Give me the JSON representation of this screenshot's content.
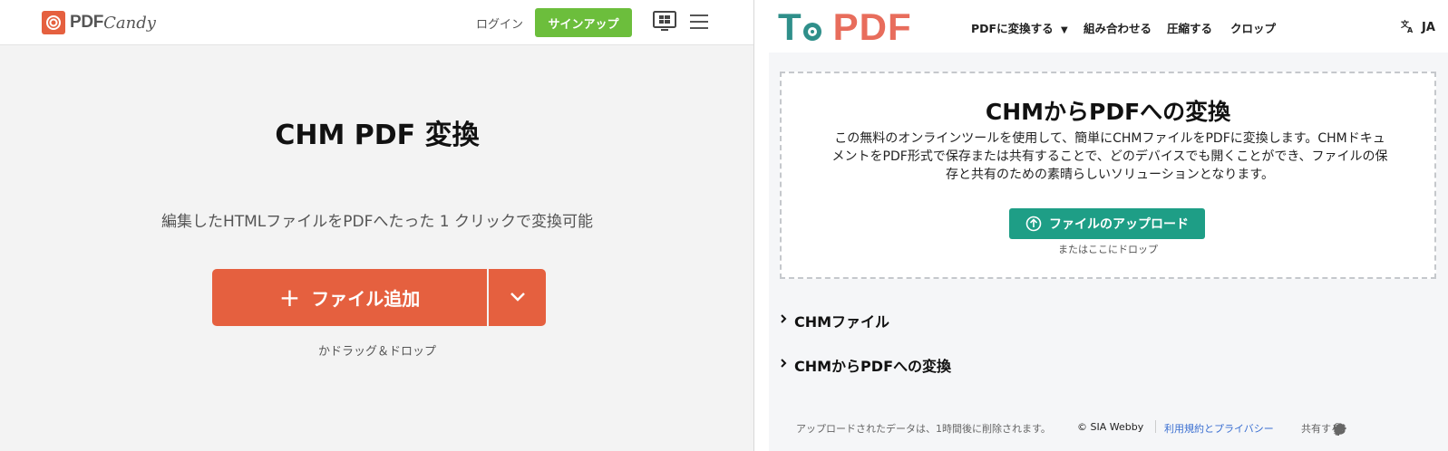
{
  "left": {
    "logo": {
      "pdf": "PDF",
      "candy": "Candy"
    },
    "header": {
      "login": "ログイン",
      "signup": "サインアップ"
    },
    "title": "CHM PDF 変換",
    "subtitle": "編集したHTMLファイルをPDFへたった 1 クリックで変換可能",
    "add_button": {
      "plus": "+",
      "label": "ファイル追加"
    },
    "drop_hint": "かドラッグ＆ドロップ",
    "colors": {
      "accent": "#e5603f",
      "signup": "#6cbe3c"
    }
  },
  "right": {
    "logo": {
      "t": "T",
      "pdf": "PDF"
    },
    "nav": {
      "convert": "PDFに変換する",
      "merge": "組み合わせる",
      "compress": "圧縮する",
      "crop": "クロップ"
    },
    "lang": "JA",
    "title": "CHMからPDFへの変換",
    "description": "この無料のオンラインツールを使用して、簡単にCHMファイルをPDFに変換します。CHMドキュメントをPDF形式で保存または共有することで、どのデバイスでも開くことができ、ファイルの保存と共有のための素晴らしいソリューションとなります。",
    "upload_button": "ファイルのアップロード",
    "or_drop": "またはここにドロップ",
    "faq": [
      {
        "label": "CHMファイル"
      },
      {
        "label": "CHMからPDFへの変換"
      }
    ],
    "footer": {
      "deletion_note": "アップロードされたデータは、1時間後に削除されます。",
      "copyright": "© SIA Webby",
      "terms": "利用規約とプライバシー",
      "share_label": "共有する:"
    },
    "colors": {
      "teal": "#2f8f8a",
      "coral": "#e86d5c",
      "upload": "#1e9e86"
    }
  }
}
